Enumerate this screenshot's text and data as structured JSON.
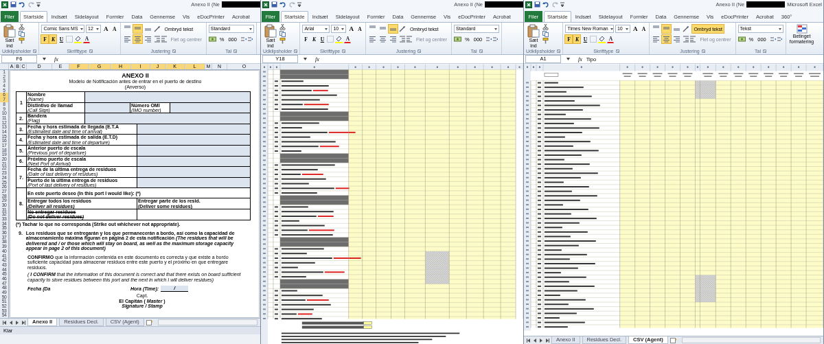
{
  "windows": [
    {
      "title": "Anexo II (Ne",
      "ribbon_tabs": [
        {
          "label": "Filer",
          "kind": "file",
          "selected": false
        },
        {
          "label": "Startside",
          "kind": "tab",
          "selected": true
        },
        {
          "label": "Indsæt",
          "kind": "tab",
          "selected": false
        },
        {
          "label": "Sidelayout",
          "kind": "tab",
          "selected": false
        },
        {
          "label": "Formler",
          "kind": "tab",
          "selected": false
        },
        {
          "label": "Data",
          "kind": "tab",
          "selected": false
        },
        {
          "label": "Gennemse",
          "kind": "tab",
          "selected": false
        },
        {
          "label": "Vis",
          "kind": "tab",
          "selected": false
        },
        {
          "label": "eDocPrinter",
          "kind": "tab",
          "selected": false
        },
        {
          "label": "Acrobat",
          "kind": "tab",
          "selected": false
        }
      ],
      "clipboard": {
        "paste_label": "Sæt ind",
        "group_label": "Udklipsholder"
      },
      "font": {
        "name": "Comic Sans MS",
        "size": "12",
        "grow_label": "A",
        "shrink_label": "A",
        "color_label": "A",
        "buttons": [
          {
            "label": "F",
            "kind": "bold",
            "on": true
          },
          {
            "label": "K",
            "kind": "italic",
            "on": true
          },
          {
            "label": "U",
            "kind": "underline",
            "on": false
          }
        ],
        "group_label": "Skrifttype"
      },
      "alignment": {
        "vertical_buttons": [
          {
            "kind": "top",
            "selected": false
          },
          {
            "kind": "middle",
            "selected": true
          },
          {
            "kind": "bottom",
            "selected": false
          }
        ],
        "horizontal_buttons": [
          {
            "kind": "left",
            "selected": false
          },
          {
            "kind": "center",
            "selected": true
          },
          {
            "kind": "right",
            "selected": false
          }
        ],
        "wrap_label": "Ombryd tekst",
        "wrap_text": false,
        "merge_label": "Flet og centrer",
        "merge_disabled": true,
        "group_label": "Justering"
      },
      "number": {
        "format": "Standard",
        "buttons": [
          "%",
          "000"
        ],
        "group_label": "Tal"
      },
      "name_box": "F6",
      "function_label": "fx",
      "columns": [
        {
          "label": "A",
          "selected": false
        },
        {
          "label": "B",
          "selected": false
        },
        {
          "label": "C",
          "selected": false
        },
        {
          "label": "D",
          "selected": false
        },
        {
          "label": "E",
          "selected": false
        },
        {
          "label": "F",
          "selected": true
        },
        {
          "label": "G",
          "selected": true
        },
        {
          "label": "H",
          "selected": true
        },
        {
          "label": "I",
          "selected": true
        },
        {
          "label": "J",
          "selected": true
        },
        {
          "label": "K",
          "selected": true
        },
        {
          "label": "L",
          "selected": true
        },
        {
          "label": "M",
          "selected": false
        },
        {
          "label": "N",
          "selected": false
        },
        {
          "label": "O",
          "selected": false
        }
      ],
      "rows": [
        {
          "label": "1",
          "selected": false
        },
        {
          "label": "2",
          "selected": false
        },
        {
          "label": "3",
          "selected": false
        },
        {
          "label": "4",
          "selected": false
        },
        {
          "label": "5",
          "selected": false
        },
        {
          "label": "6",
          "selected": true
        },
        {
          "label": "7",
          "selected": true
        },
        {
          "label": "8",
          "selected": false
        },
        {
          "label": "9",
          "selected": false
        },
        {
          "label": "10",
          "selected": false
        },
        {
          "label": "11",
          "selected": false
        },
        {
          "label": "12",
          "selected": false
        },
        {
          "label": "13",
          "selected": false
        },
        {
          "label": "14",
          "selected": false
        },
        {
          "label": "15",
          "selected": false
        },
        {
          "label": "16",
          "selected": false
        },
        {
          "label": "17",
          "selected": false
        },
        {
          "label": "18",
          "selected": false
        },
        {
          "label": "19",
          "selected": false
        },
        {
          "label": "20",
          "selected": false
        },
        {
          "label": "21",
          "selected": false
        },
        {
          "label": "22",
          "selected": false
        },
        {
          "label": "23",
          "selected": false
        },
        {
          "label": "24",
          "selected": false
        },
        {
          "label": "25",
          "selected": false
        },
        {
          "label": "26",
          "selected": false
        },
        {
          "label": "27",
          "selected": false
        },
        {
          "label": "28",
          "selected": false
        },
        {
          "label": "29",
          "selected": false
        },
        {
          "label": "30",
          "selected": false
        },
        {
          "label": "31",
          "selected": false
        },
        {
          "label": "32",
          "selected": false
        },
        {
          "label": "33",
          "selected": false
        },
        {
          "label": "34",
          "selected": false
        },
        {
          "label": "35",
          "selected": false
        },
        {
          "label": "36",
          "selected": false
        },
        {
          "label": "37",
          "selected": false
        },
        {
          "label": "38",
          "selected": false
        },
        {
          "label": "39",
          "selected": false
        },
        {
          "label": "40",
          "selected": false
        },
        {
          "label": "41",
          "selected": false
        },
        {
          "label": "42",
          "selected": false
        },
        {
          "label": "43",
          "selected": false
        },
        {
          "label": "44",
          "selected": false
        },
        {
          "label": "45",
          "selected": false
        },
        {
          "label": "46",
          "selected": false
        },
        {
          "label": "47",
          "selected": false
        },
        {
          "label": "48",
          "selected": false
        },
        {
          "label": "49",
          "selected": false
        },
        {
          "label": "50",
          "selected": false
        },
        {
          "label": "51",
          "selected": false
        },
        {
          "label": "52",
          "selected": false
        },
        {
          "label": "53",
          "selected": false
        },
        {
          "label": "54",
          "selected": false
        }
      ],
      "sheet": {
        "kind": "form",
        "title": "ANEXO II",
        "subtitle": "Modelo  de Notificación antes de entrar en el puerto de destino",
        "side": "(Anverso)",
        "sections": [
          {
            "number": "1",
            "lines": [
              {
                "cells": [
                  {
                    "kind": "label",
                    "text": "Nombre",
                    "text_en": "(Name)"
                  },
                  {
                    "kind": "value"
                  }
                ]
              },
              {
                "cells": [
                  {
                    "kind": "label",
                    "text": "Distintivo de llamad",
                    "text_en": "(Call Sign)"
                  },
                  {
                    "kind": "value_short"
                  },
                  {
                    "kind": "label_mid",
                    "text": "Número OMI",
                    "text_en": "(IMO number)"
                  },
                  {
                    "kind": "value"
                  }
                ]
              }
            ]
          },
          {
            "number": "2.",
            "lines": [
              {
                "cells": [
                  {
                    "kind": "label",
                    "text": "Bandera",
                    "text_en": "(Flag)"
                  },
                  {
                    "kind": "value"
                  }
                ]
              }
            ]
          },
          {
            "number": "3.",
            "lines": [
              {
                "cells": [
                  {
                    "kind": "label_long",
                    "text": "Fecha y hora estimada de llegada (E.T.A",
                    "text_en": "(Estimated date and time of arrival)"
                  },
                  {
                    "kind": "value"
                  }
                ]
              }
            ]
          },
          {
            "number": "4.",
            "lines": [
              {
                "cells": [
                  {
                    "kind": "label_long",
                    "text": "Fecha y hora estimada de salida (E.T.D)",
                    "text_en": "(Estimated date and time of departure)"
                  },
                  {
                    "kind": "value"
                  }
                ]
              }
            ]
          },
          {
            "number": "5.",
            "lines": [
              {
                "cells": [
                  {
                    "kind": "label_long",
                    "text": "Anterior puerto de escala",
                    "text_en": "(Previous port of departure)"
                  },
                  {
                    "kind": "value"
                  }
                ]
              }
            ]
          },
          {
            "number": "6.",
            "lines": [
              {
                "cells": [
                  {
                    "kind": "label_long",
                    "text": "Próximo puerto de escala",
                    "text_en": "(Next Port of Arrival)"
                  },
                  {
                    "kind": "value"
                  }
                ]
              }
            ]
          },
          {
            "number": "7.",
            "lines": [
              {
                "cells": [
                  {
                    "kind": "label_long",
                    "text": "Fecha de la última entrega de residuos",
                    "text_en": "(Date of last delivery of residues)"
                  },
                  {
                    "kind": "value"
                  }
                ]
              },
              {
                "cells": [
                  {
                    "kind": "label_long",
                    "text": "Puerto de la última entrega de residuos",
                    "text_en": "(Port of last delivery of residues)"
                  },
                  {
                    "kind": "value"
                  }
                ]
              }
            ]
          },
          {
            "number": "8.",
            "lines": [
              {
                "cells": [
                  {
                    "kind": "heading",
                    "text": "En este puerto deseo (In this port I would like): (*)"
                  }
                ]
              },
              {
                "cells": [
                  {
                    "kind": "option_long",
                    "text": "Entregar todos los residuos",
                    "text_en": "(Deliver all residues)",
                    "struck": false
                  },
                  {
                    "kind": "option",
                    "text": "Entregar parte de los resid.",
                    "text_en": "(Deliver some residues)",
                    "struck": false
                  }
                ]
              },
              {
                "cells": [
                  {
                    "kind": "option_long",
                    "text": "No entregar residuos",
                    "text_en": "(Do not deliver residues)",
                    "struck": true
                  },
                  {
                    "kind": "blank"
                  }
                ]
              }
            ]
          }
        ],
        "footnote": "(*)  Tachar lo que no corresponda   (Strike out whichever not appropriate).",
        "item_number": "9.",
        "item_text": "Los residuos que se entregarán y los que permanecerán a bordo, así como la capacidad de almacenamiento máxima figuran en página 2 de esta notificación  *(The residues that will be delivered and / or those which will stay on board, as well as the maximum storage capacity appear in page 2 of this document)*",
        "confirm_es": "**CONFIRMO** que la información contenida en este documento es correcta y que existe a bordo suficiente capacidad para almacenar residuos entre este puerto y el próximo en que entregare residuos.",
        "confirm_en": "( **I CONFIRM**  that the information of this document is correct and that there exists on board sufficient capacity to store residues between this port and the next in which I will deliver residues)",
        "date_label": "Fecha (Da",
        "time_label": "Hora (Time):",
        "time_sep": "/",
        "capt": "Capt.",
        "master": "El Capitán ( *Master* )",
        "signature": "Signature / Stamp"
      },
      "sheet_tabs": [
        {
          "label": "Anexo II",
          "selected": true
        },
        {
          "label": "Residues Decl.",
          "selected": false
        },
        {
          "label": "CSV (Agent)",
          "selected": false
        }
      ],
      "status": "Klar"
    },
    {
      "title": "Anexo II (Ne",
      "ribbon_tabs": [
        {
          "label": "Filer",
          "kind": "file",
          "selected": false
        },
        {
          "label": "Startside",
          "kind": "tab",
          "selected": true
        },
        {
          "label": "Indsæt",
          "kind": "tab",
          "selected": false
        },
        {
          "label": "Sidelayout",
          "kind": "tab",
          "selected": false
        },
        {
          "label": "Formler",
          "kind": "tab",
          "selected": false
        },
        {
          "label": "Data",
          "kind": "tab",
          "selected": false
        },
        {
          "label": "Gennemse",
          "kind": "tab",
          "selected": false
        },
        {
          "label": "Vis",
          "kind": "tab",
          "selected": false
        },
        {
          "label": "eDocPrinter",
          "kind": "tab",
          "selected": false
        },
        {
          "label": "Acrobat",
          "kind": "tab",
          "selected": false
        }
      ],
      "clipboard": {
        "paste_label": "Sæt ind",
        "group_label": "Udklipsholder"
      },
      "font": {
        "name": "Arial",
        "size": "10",
        "grow_label": "A",
        "shrink_label": "A",
        "color_label": "A",
        "buttons": [
          {
            "label": "F",
            "kind": "bold",
            "on": false
          },
          {
            "label": "K",
            "kind": "italic",
            "on": false
          },
          {
            "label": "U",
            "kind": "underline",
            "on": false
          }
        ],
        "group_label": "Skrifttype"
      },
      "alignment": {
        "vertical_buttons": [
          {
            "kind": "top",
            "selected": false
          },
          {
            "kind": "middle",
            "selected": false
          },
          {
            "kind": "bottom",
            "selected": true
          }
        ],
        "horizontal_buttons": [
          {
            "kind": "left",
            "selected": false
          },
          {
            "kind": "center",
            "selected": false
          },
          {
            "kind": "right",
            "selected": false
          }
        ],
        "wrap_label": "Ombryd tekst",
        "wrap_text": false,
        "merge_label": "Flet og centrer",
        "merge_disabled": true,
        "group_label": "Justering"
      },
      "number": {
        "format": "Standard",
        "buttons": [
          "%",
          "000"
        ],
        "group_label": "Tal"
      },
      "name_box": "Y18",
      "function_label": "fx",
      "sheet": {
        "kind": "declaration"
      }
    },
    {
      "title": "Anexo II (Ne",
      "title_suffix": "Microsoft Excel",
      "ribbon_tabs": [
        {
          "label": "Filer",
          "kind": "file",
          "selected": false
        },
        {
          "label": "Startside",
          "kind": "tab",
          "selected": true
        },
        {
          "label": "Indsæt",
          "kind": "tab",
          "selected": false
        },
        {
          "label": "Sidelayout",
          "kind": "tab",
          "selected": false
        },
        {
          "label": "Formler",
          "kind": "tab",
          "selected": false
        },
        {
          "label": "Data",
          "kind": "tab",
          "selected": false
        },
        {
          "label": "Gennemse",
          "kind": "tab",
          "selected": false
        },
        {
          "label": "Vis",
          "kind": "tab",
          "selected": false
        },
        {
          "label": "eDocPrinter",
          "kind": "tab",
          "selected": false
        },
        {
          "label": "Acrobat",
          "kind": "tab",
          "selected": false
        },
        {
          "label": "360°",
          "kind": "tab",
          "selected": false
        }
      ],
      "clipboard": {
        "paste_label": "Sæt ind",
        "group_label": "Udklipsholder"
      },
      "font": {
        "name": "Times New Roman",
        "size": "10",
        "grow_label": "A",
        "shrink_label": "A",
        "color_label": "A",
        "buttons": [
          {
            "label": "F",
            "kind": "bold",
            "on": true
          },
          {
            "label": "K",
            "kind": "italic",
            "on": true
          },
          {
            "label": "U",
            "kind": "underline",
            "on": false
          }
        ],
        "group_label": "Skrifttype"
      },
      "alignment": {
        "vertical_buttons": [
          {
            "kind": "top",
            "selected": false
          },
          {
            "kind": "middle",
            "selected": true
          },
          {
            "kind": "bottom",
            "selected": false
          }
        ],
        "horizontal_buttons": [
          {
            "kind": "left",
            "selected": false
          },
          {
            "kind": "center",
            "selected": true
          },
          {
            "kind": "right",
            "selected": false
          }
        ],
        "wrap_label": "Ombryd tekst",
        "wrap_text": true,
        "merge_label": "Flet og centrer",
        "merge_disabled": true,
        "group_label": "Justering"
      },
      "number": {
        "format": "Tekst",
        "buttons": [
          "%",
          "000"
        ],
        "group_label": "Tal"
      },
      "conditional_formatting": "Betinget formatering",
      "name_box": "A1",
      "function_label": "fx",
      "formula": "Tipo",
      "sheet": {
        "kind": "table"
      },
      "sheet_tabs": [
        {
          "label": "Anexo II",
          "selected": false
        },
        {
          "label": "Residues Decl.",
          "selected": false
        },
        {
          "label": "CSV (Agent)",
          "selected": true
        }
      ]
    }
  ]
}
